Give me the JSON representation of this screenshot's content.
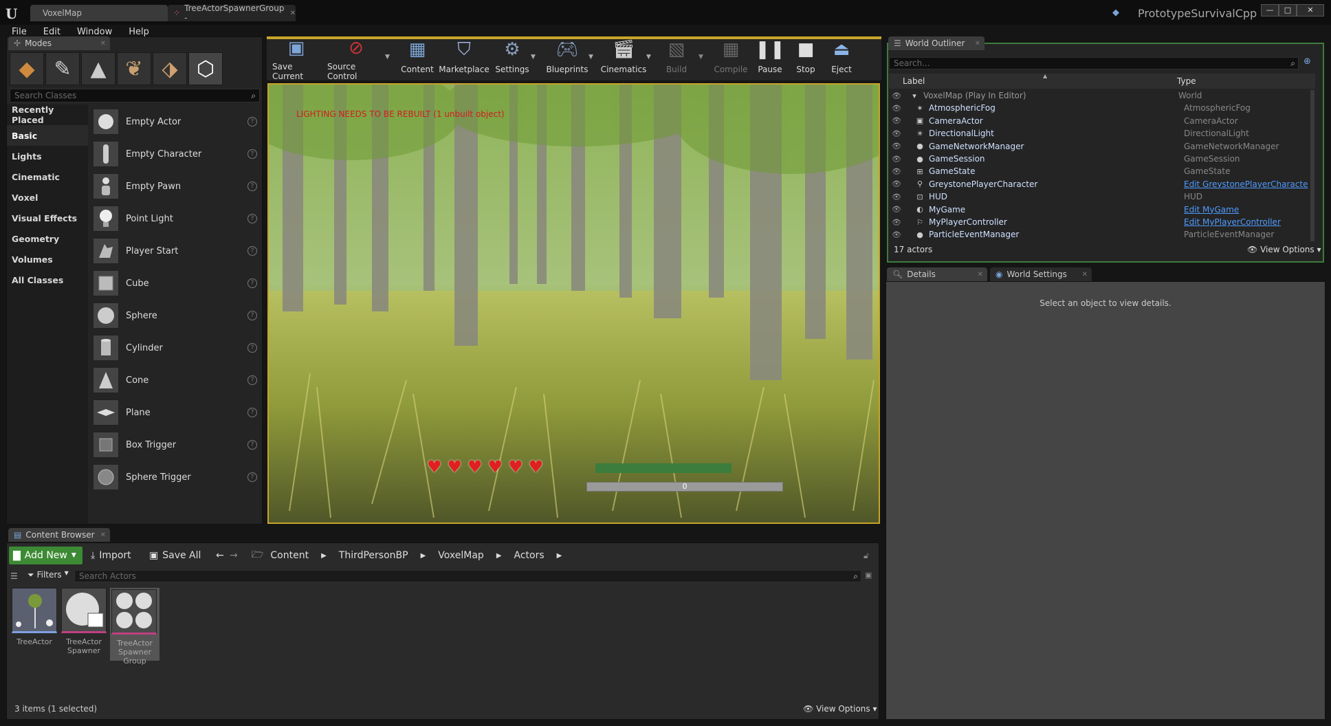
{
  "window": {
    "tabs": [
      "VoxelMap",
      "TreeActorSpawnerGroup -"
    ],
    "project": "PrototypeSurvivalCpp",
    "controls": [
      "—",
      "□",
      "✕"
    ]
  },
  "menu": [
    "File",
    "Edit",
    "Window",
    "Help"
  ],
  "modes": {
    "tab": "Modes",
    "search_placeholder": "Search Classes",
    "categories": [
      "Recently Placed",
      "Basic",
      "Lights",
      "Cinematic",
      "Voxel",
      "Visual Effects",
      "Geometry",
      "Volumes",
      "All Classes"
    ],
    "selected_category": "Basic",
    "items": [
      "Empty Actor",
      "Empty Character",
      "Empty Pawn",
      "Point Light",
      "Player Start",
      "Cube",
      "Sphere",
      "Cylinder",
      "Cone",
      "Plane",
      "Box Trigger",
      "Sphere Trigger"
    ]
  },
  "toolbar": {
    "buttons": [
      {
        "label": "Save Current",
        "icon": "save-icon",
        "enabled": true
      },
      {
        "label": "Source Control",
        "icon": "source-control-icon",
        "enabled": true
      },
      {
        "label": "Content",
        "icon": "content-icon",
        "enabled": true
      },
      {
        "label": "Marketplace",
        "icon": "marketplace-icon",
        "enabled": true
      },
      {
        "label": "Settings",
        "icon": "settings-icon",
        "enabled": true
      },
      {
        "label": "Blueprints",
        "icon": "blueprints-icon",
        "enabled": true
      },
      {
        "label": "Cinematics",
        "icon": "cinematics-icon",
        "enabled": true
      },
      {
        "label": "Build",
        "icon": "build-icon",
        "enabled": false
      },
      {
        "label": "Compile",
        "icon": "compile-icon",
        "enabled": false
      },
      {
        "label": "Pause",
        "icon": "pause-icon",
        "enabled": true
      },
      {
        "label": "Stop",
        "icon": "stop-icon",
        "enabled": true
      },
      {
        "label": "Eject",
        "icon": "eject-icon",
        "enabled": true
      }
    ]
  },
  "viewport": {
    "warning": "LIGHTING NEEDS TO BE REBUILT (1 unbuilt object)",
    "hearts": 6,
    "health_fill": 1.0,
    "progress_value": "0"
  },
  "outliner": {
    "tab": "World Outliner",
    "search_placeholder": "Search...",
    "col_label": "Label",
    "col_type": "Type",
    "rows": [
      {
        "label": "VoxelMap (Play In Editor)",
        "type": "World",
        "link": false
      },
      {
        "label": "AtmosphericFog",
        "type": "AtmosphericFog",
        "link": false
      },
      {
        "label": "CameraActor",
        "type": "CameraActor",
        "link": false
      },
      {
        "label": "DirectionalLight",
        "type": "DirectionalLight",
        "link": false
      },
      {
        "label": "GameNetworkManager",
        "type": "GameNetworkManager",
        "link": false
      },
      {
        "label": "GameSession",
        "type": "GameSession",
        "link": false
      },
      {
        "label": "GameState",
        "type": "GameState",
        "link": false
      },
      {
        "label": "GreystonePlayerCharacter",
        "type": "Edit GreystonePlayerCharacte",
        "link": true
      },
      {
        "label": "HUD",
        "type": "HUD",
        "link": false
      },
      {
        "label": "MyGame",
        "type": "Edit MyGame",
        "link": true
      },
      {
        "label": "MyPlayerController",
        "type": "Edit MyPlayerController",
        "link": true
      },
      {
        "label": "ParticleEventManager",
        "type": "ParticleEventManager",
        "link": false
      }
    ],
    "count": "17 actors",
    "view_options": "View Options"
  },
  "details": {
    "tabs": [
      "Details",
      "World Settings"
    ],
    "empty_text": "Select an object to view details."
  },
  "content_browser": {
    "tab": "Content Browser",
    "add_new": "Add New",
    "import": "Import",
    "save_all": "Save All",
    "breadcrumb": [
      "Content",
      "ThirdPersonBP",
      "VoxelMap",
      "Actors"
    ],
    "filters": "Filters",
    "search_placeholder": "Search Actors",
    "assets": [
      {
        "name": "TreeActor",
        "lines": [
          "TreeActor"
        ]
      },
      {
        "name": "TreeActorSpawner",
        "lines": [
          "TreeActor",
          "Spawner"
        ]
      },
      {
        "name": "TreeActorSpawnerGroup",
        "lines": [
          "TreeActor",
          "Spawner",
          "Group"
        ]
      }
    ],
    "status": "3 items (1 selected)",
    "view_options": "View Options"
  }
}
